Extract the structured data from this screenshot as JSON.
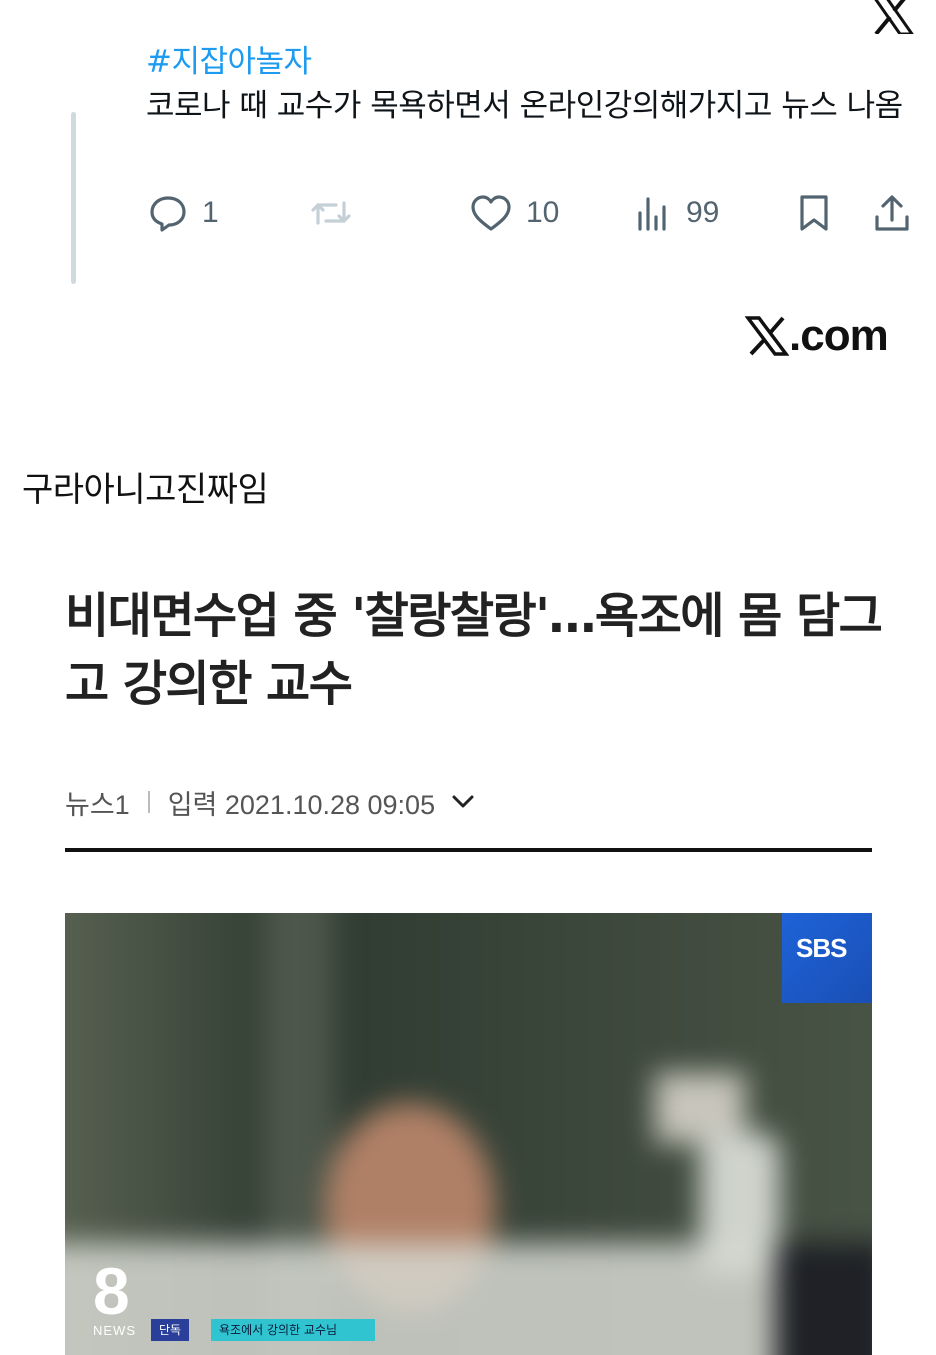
{
  "tweet": {
    "hashtag": "#지잡아놀자",
    "text": "코로나 때 교수가 목욕하면서 온라인강의해가지고 뉴스 나옴",
    "replies": "1",
    "retweets": "",
    "likes": "10",
    "views": "99",
    "icons": [
      "reply-icon",
      "retweet-icon",
      "like-icon",
      "views-icon",
      "bookmark-icon",
      "share-icon"
    ],
    "colors": {
      "hashtag": "#1d9bf0",
      "icon": "#536471"
    }
  },
  "branding": {
    "site": ".com"
  },
  "post": {
    "caption": "구라아니고진짜임"
  },
  "article": {
    "headline": "비대면수업 중 '찰랑찰랑'…욕조에 몸 담그고 강의한 교수",
    "source": "뉴스1",
    "date_label": "입력 2021.10.28 09:05"
  },
  "video": {
    "broadcaster": "SBS",
    "program_number": "8",
    "program_label": "NEWS",
    "tag": "단독",
    "lower_third": "욕조에서 강의한 교수님"
  }
}
